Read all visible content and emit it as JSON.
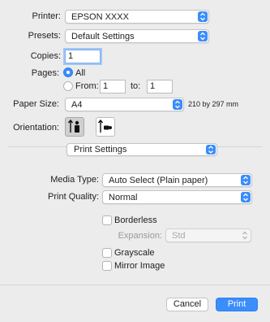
{
  "printer": {
    "label": "Printer:",
    "value": "EPSON XXXX"
  },
  "presets": {
    "label": "Presets:",
    "value": "Default Settings"
  },
  "copies": {
    "label": "Copies:",
    "value": "1"
  },
  "pages": {
    "label": "Pages:",
    "all_label": "All",
    "from_label": "From:",
    "from_value": "1",
    "to_label": "to:",
    "to_value": "1"
  },
  "paper_size": {
    "label": "Paper Size:",
    "value": "A4",
    "dimensions": "210 by 297 mm"
  },
  "orientation": {
    "label": "Orientation:",
    "selected": "portrait"
  },
  "section": {
    "value": "Print Settings"
  },
  "media_type": {
    "label": "Media Type:",
    "value": "Auto Select (Plain paper)"
  },
  "print_quality": {
    "label": "Print Quality:",
    "value": "Normal"
  },
  "borderless": {
    "label": "Borderless",
    "checked": false
  },
  "expansion": {
    "label": "Expansion:",
    "value": "Std"
  },
  "grayscale": {
    "label": "Grayscale",
    "checked": false
  },
  "mirror_image": {
    "label": "Mirror Image",
    "checked": false
  },
  "buttons": {
    "cancel": "Cancel",
    "print": "Print"
  },
  "colors": {
    "accent": "#3a8dfc",
    "background": "#ececec"
  }
}
